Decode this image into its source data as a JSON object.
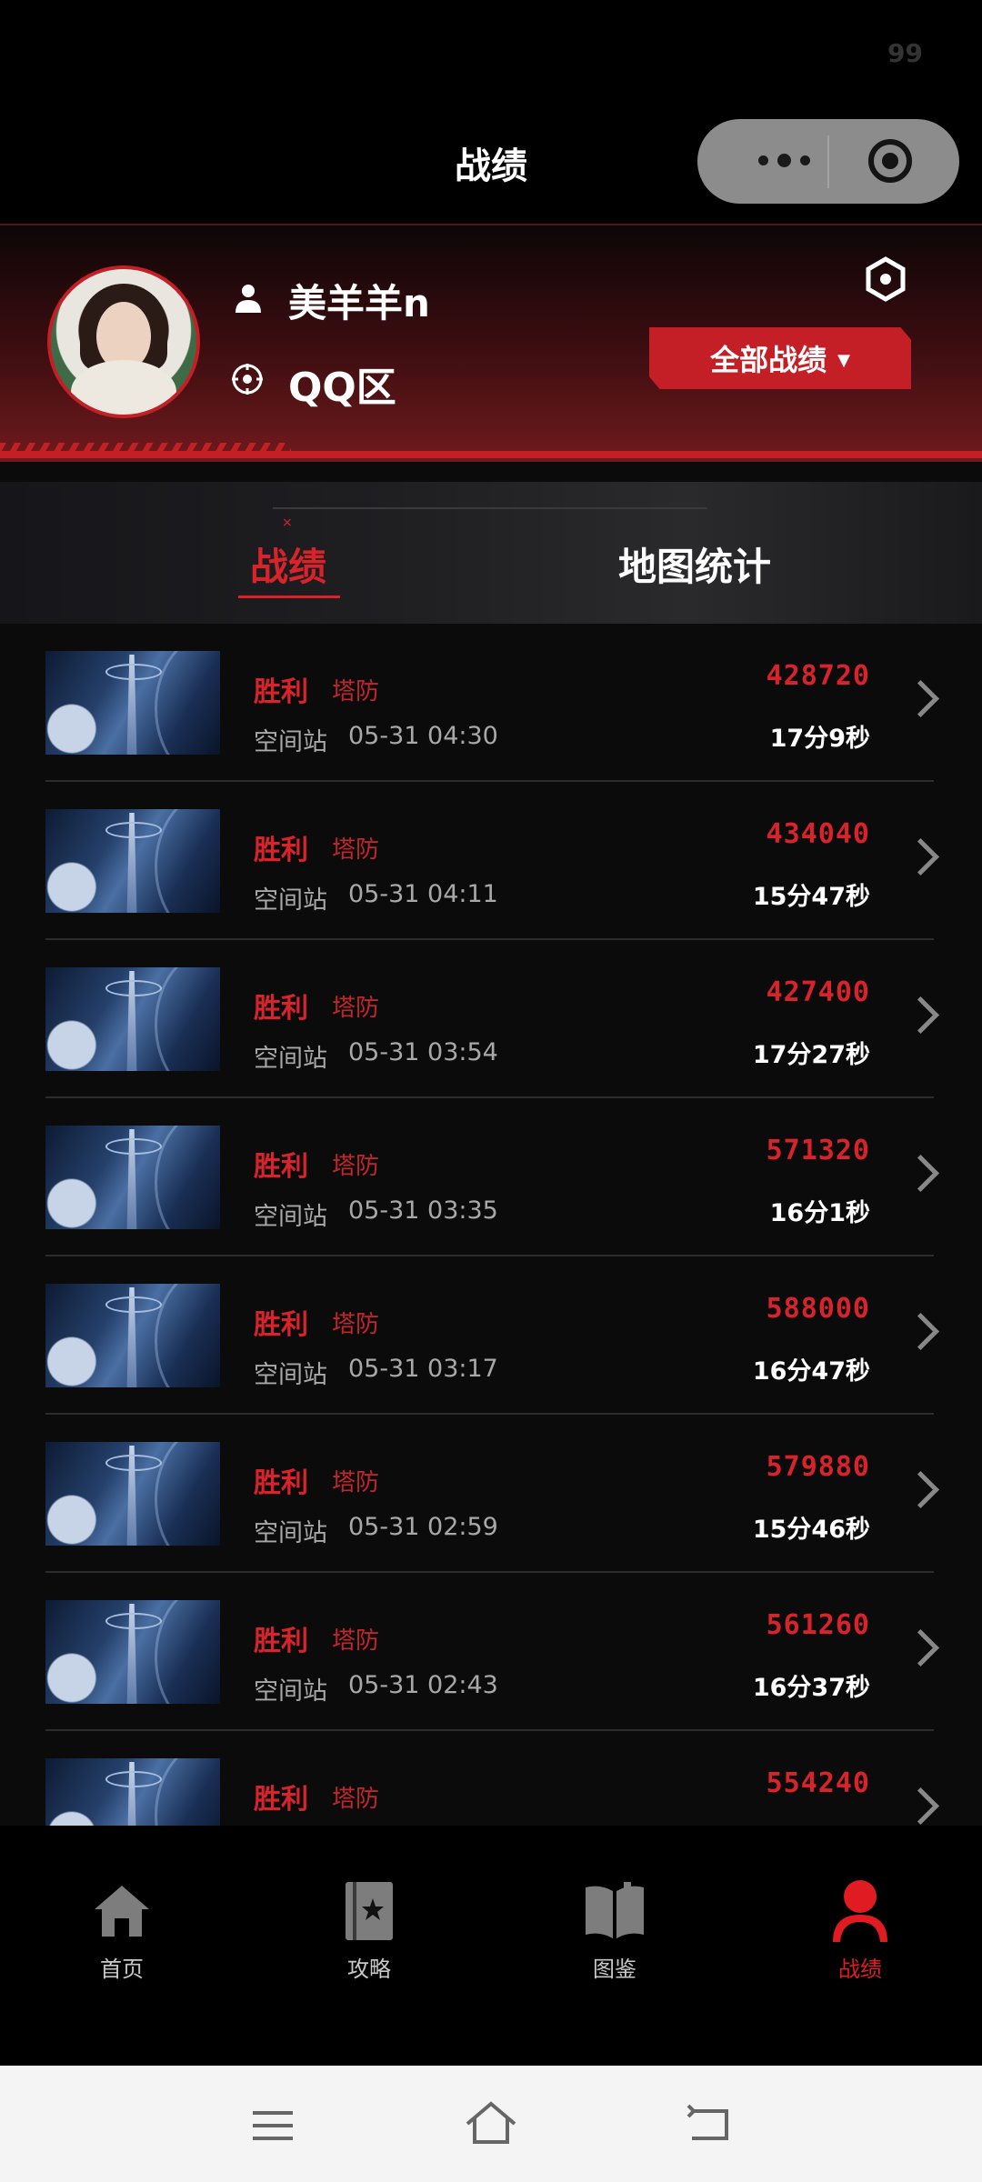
{
  "status": {
    "right_text": "99"
  },
  "header": {
    "title": "战绩"
  },
  "profile": {
    "username": "美羊羊n",
    "zone": "QQ区",
    "filter_button": "全部战绩",
    "filter_caret": "▼"
  },
  "tabs": [
    {
      "label": "战绩",
      "active": true
    },
    {
      "label": "地图统计",
      "active": false
    }
  ],
  "records": [
    {
      "result": "胜利",
      "mode": "塔防",
      "map": "空间站",
      "datetime": "05-31 04:30",
      "score": "428720",
      "duration": "17分9秒"
    },
    {
      "result": "胜利",
      "mode": "塔防",
      "map": "空间站",
      "datetime": "05-31 04:11",
      "score": "434040",
      "duration": "15分47秒"
    },
    {
      "result": "胜利",
      "mode": "塔防",
      "map": "空间站",
      "datetime": "05-31 03:54",
      "score": "427400",
      "duration": "17分27秒"
    },
    {
      "result": "胜利",
      "mode": "塔防",
      "map": "空间站",
      "datetime": "05-31 03:35",
      "score": "571320",
      "duration": "16分1秒"
    },
    {
      "result": "胜利",
      "mode": "塔防",
      "map": "空间站",
      "datetime": "05-31 03:17",
      "score": "588000",
      "duration": "16分47秒"
    },
    {
      "result": "胜利",
      "mode": "塔防",
      "map": "空间站",
      "datetime": "05-31 02:59",
      "score": "579880",
      "duration": "15分46秒"
    },
    {
      "result": "胜利",
      "mode": "塔防",
      "map": "空间站",
      "datetime": "05-31 02:43",
      "score": "561260",
      "duration": "16分37秒"
    },
    {
      "result": "胜利",
      "mode": "塔防",
      "map": "",
      "datetime": "",
      "score": "554240",
      "duration": ""
    }
  ],
  "bottom_nav": [
    {
      "label": "首页",
      "icon": "home-icon",
      "active": false
    },
    {
      "label": "攻略",
      "icon": "guide-book-icon",
      "active": false
    },
    {
      "label": "图鉴",
      "icon": "open-book-icon",
      "active": false
    },
    {
      "label": "战绩",
      "icon": "person-icon",
      "active": true
    }
  ],
  "colors": {
    "accent": "#d8232a",
    "background": "#0b0b0c"
  }
}
